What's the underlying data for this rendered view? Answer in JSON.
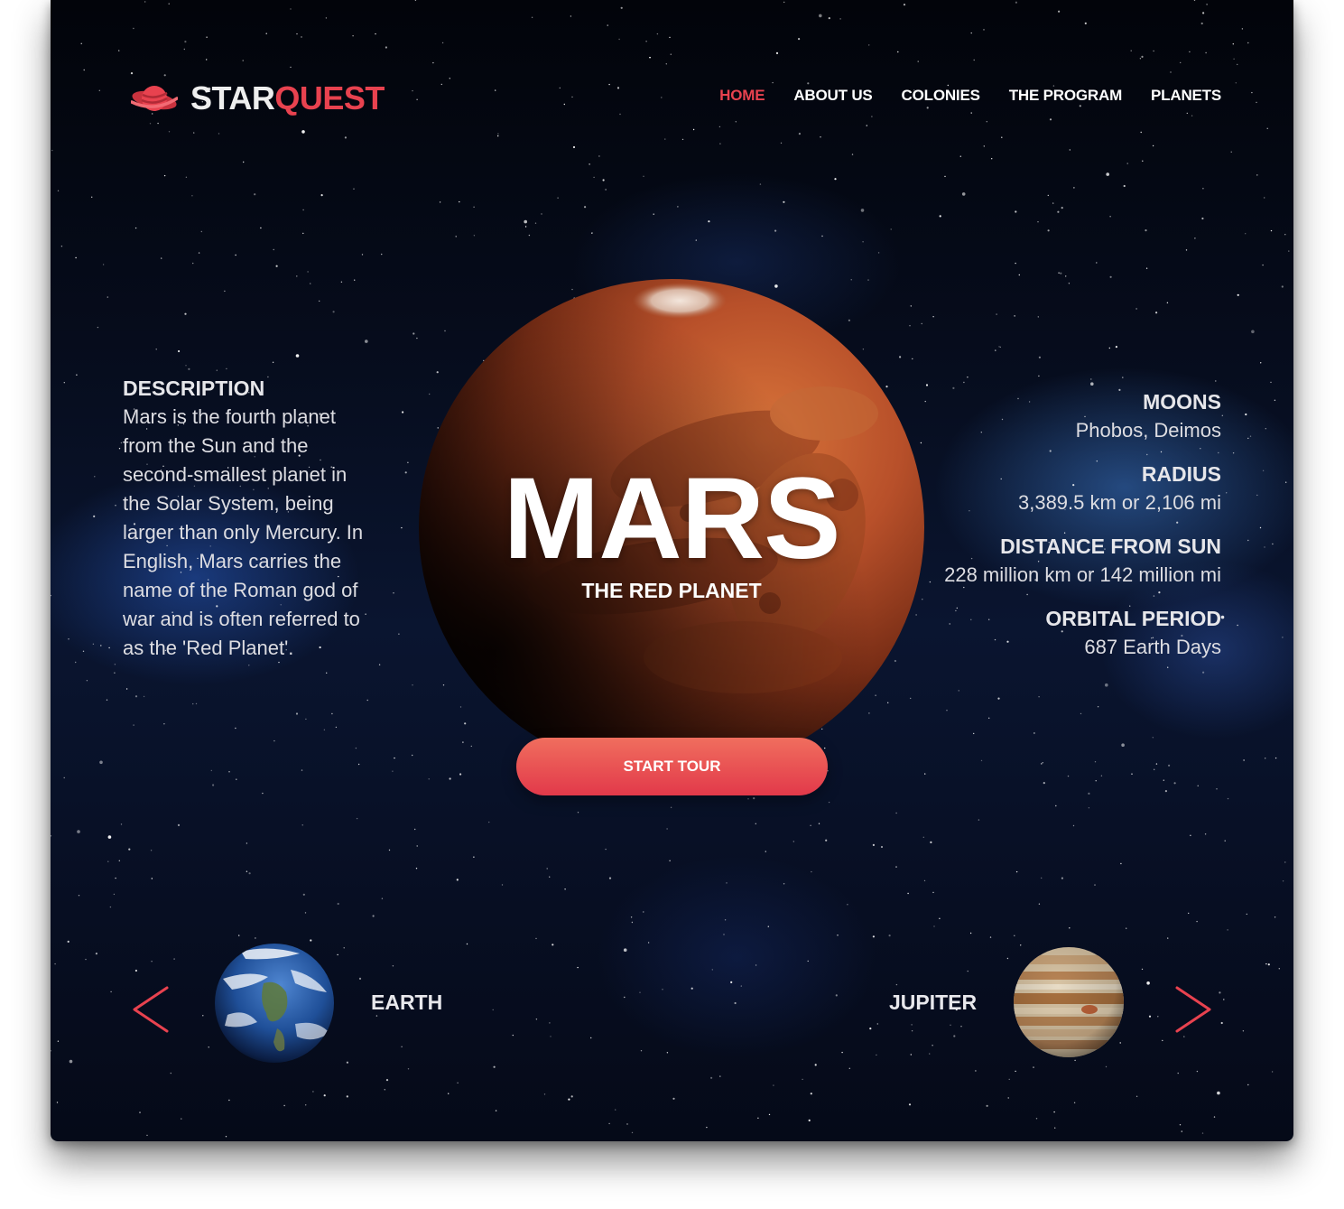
{
  "brand": {
    "name_primary": "STAR",
    "name_accent": "QUEST",
    "accent_color": "#e8424f"
  },
  "nav": {
    "items": [
      {
        "label": "HOME",
        "active": true
      },
      {
        "label": "ABOUT US",
        "active": false
      },
      {
        "label": "COLONIES",
        "active": false
      },
      {
        "label": "THE PROGRAM",
        "active": false
      },
      {
        "label": "PLANETS",
        "active": false
      }
    ]
  },
  "description": {
    "title": "DESCRIPTION",
    "text": "Mars is the fourth planet from the Sun and the second-smallest planet in the Solar System, being larger than only Mercury. In English, Mars carries the name of the Roman god of war and is often referred to as the 'Red Planet'."
  },
  "planet": {
    "name": "MARS",
    "subtitle": "THE RED PLANET",
    "cta_label": "START TOUR"
  },
  "stats": [
    {
      "label": "MOONS",
      "value": "Phobos, Deimos"
    },
    {
      "label": "RADIUS",
      "value": "3,389.5 km or 2,106 mi"
    },
    {
      "label": "DISTANCE FROM SUN",
      "value": "228 million km or 142 million mi"
    },
    {
      "label": "ORBITAL PERIOD",
      "value": "687 Earth Days"
    }
  ],
  "carousel": {
    "prev": {
      "label": "EARTH",
      "icon": "chevron-left-icon"
    },
    "next": {
      "label": "JUPITER",
      "icon": "chevron-right-icon"
    }
  }
}
